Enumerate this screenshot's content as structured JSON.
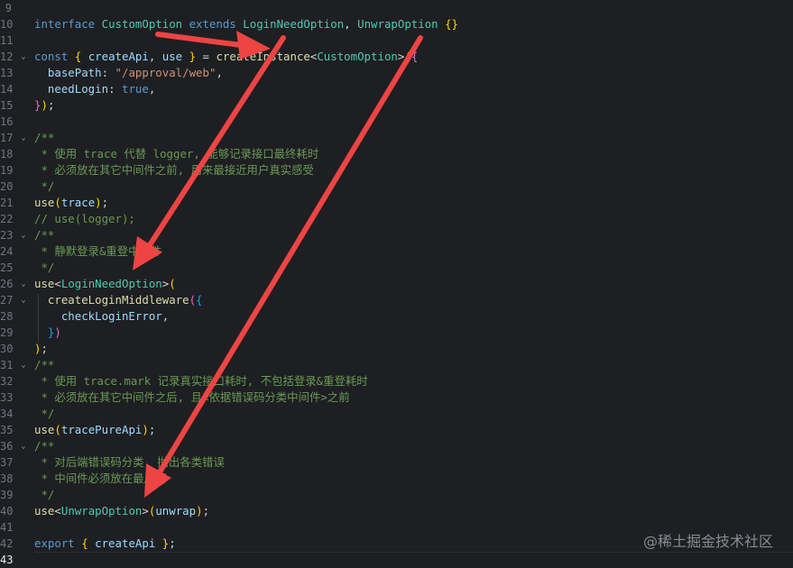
{
  "editor": {
    "lines": [
      {
        "num": "9",
        "fold": "",
        "tokens": []
      },
      {
        "num": "10",
        "fold": "",
        "tokens": [
          {
            "t": "interface ",
            "c": "kw"
          },
          {
            "t": "CustomOption ",
            "c": "type"
          },
          {
            "t": "extends ",
            "c": "kw"
          },
          {
            "t": "LoginNeedOption",
            "c": "type"
          },
          {
            "t": ", ",
            "c": "pun"
          },
          {
            "t": "UnwrapOption ",
            "c": "type"
          },
          {
            "t": "{}",
            "c": "p1"
          }
        ]
      },
      {
        "num": "11",
        "fold": "",
        "tokens": []
      },
      {
        "num": "12",
        "fold": "⌄",
        "tokens": [
          {
            "t": "const ",
            "c": "kw"
          },
          {
            "t": "{ ",
            "c": "p1"
          },
          {
            "t": "createApi",
            "c": "var"
          },
          {
            "t": ", ",
            "c": "pun"
          },
          {
            "t": "use ",
            "c": "var"
          },
          {
            "t": "} ",
            "c": "p1"
          },
          {
            "t": "= ",
            "c": "pun"
          },
          {
            "t": "createInstance",
            "c": "fn"
          },
          {
            "t": "<",
            "c": "pun"
          },
          {
            "t": "CustomOption",
            "c": "type"
          },
          {
            "t": ">",
            "c": "pun"
          },
          {
            "t": "(",
            "c": "p1"
          },
          {
            "t": "{",
            "c": "p2"
          }
        ]
      },
      {
        "num": "13",
        "fold": "",
        "tokens": [
          {
            "t": "  basePath",
            "c": "prop"
          },
          {
            "t": ": ",
            "c": "pun"
          },
          {
            "t": "\"/approval/web\"",
            "c": "str"
          },
          {
            "t": ",",
            "c": "pun"
          }
        ]
      },
      {
        "num": "14",
        "fold": "",
        "tokens": [
          {
            "t": "  needLogin",
            "c": "prop"
          },
          {
            "t": ": ",
            "c": "pun"
          },
          {
            "t": "true",
            "c": "bool"
          },
          {
            "t": ",",
            "c": "pun"
          }
        ]
      },
      {
        "num": "15",
        "fold": "",
        "tokens": [
          {
            "t": "}",
            "c": "p2"
          },
          {
            "t": ")",
            "c": "p1"
          },
          {
            "t": ";",
            "c": "pun"
          }
        ]
      },
      {
        "num": "16",
        "fold": "",
        "tokens": []
      },
      {
        "num": "17",
        "fold": "⌄",
        "tokens": [
          {
            "t": "/**",
            "c": "cmt"
          }
        ]
      },
      {
        "num": "18",
        "fold": "",
        "tokens": [
          {
            "t": " * 使用 trace 代替 logger, 能够记录接口最终耗时",
            "c": "cmt"
          }
        ]
      },
      {
        "num": "19",
        "fold": "",
        "tokens": [
          {
            "t": " * 必须放在其它中间件之前, 用来最接近用户真实感受",
            "c": "cmt"
          }
        ]
      },
      {
        "num": "20",
        "fold": "",
        "tokens": [
          {
            "t": " */",
            "c": "cmt"
          }
        ]
      },
      {
        "num": "21",
        "fold": "",
        "tokens": [
          {
            "t": "use",
            "c": "fn"
          },
          {
            "t": "(",
            "c": "p1"
          },
          {
            "t": "trace",
            "c": "var"
          },
          {
            "t": ")",
            "c": "p1"
          },
          {
            "t": ";",
            "c": "pun"
          }
        ]
      },
      {
        "num": "22",
        "fold": "",
        "tokens": [
          {
            "t": "// use(logger);",
            "c": "cmt"
          }
        ]
      },
      {
        "num": "23",
        "fold": "⌄",
        "tokens": [
          {
            "t": "/**",
            "c": "cmt"
          }
        ]
      },
      {
        "num": "24",
        "fold": "",
        "tokens": [
          {
            "t": " * 静默登录&重登中间件",
            "c": "cmt"
          }
        ]
      },
      {
        "num": "25",
        "fold": "",
        "tokens": [
          {
            "t": " */",
            "c": "cmt"
          }
        ]
      },
      {
        "num": "26",
        "fold": "⌄",
        "tokens": [
          {
            "t": "use",
            "c": "fn"
          },
          {
            "t": "<",
            "c": "pun"
          },
          {
            "t": "LoginNeedOption",
            "c": "type"
          },
          {
            "t": ">",
            "c": "pun"
          },
          {
            "t": "(",
            "c": "p1"
          }
        ]
      },
      {
        "num": "27",
        "fold": "⌄",
        "tokens": [
          {
            "t": "  createLoginMiddleware",
            "c": "fn"
          },
          {
            "t": "(",
            "c": "p2"
          },
          {
            "t": "{",
            "c": "p3"
          }
        ]
      },
      {
        "num": "28",
        "fold": "",
        "tokens": [
          {
            "t": "    checkLoginError",
            "c": "var"
          },
          {
            "t": ",",
            "c": "pun"
          }
        ]
      },
      {
        "num": "29",
        "fold": "",
        "tokens": [
          {
            "t": "  ",
            "c": "pun"
          },
          {
            "t": "}",
            "c": "p3"
          },
          {
            "t": ")",
            "c": "p2"
          }
        ]
      },
      {
        "num": "30",
        "fold": "",
        "tokens": [
          {
            "t": ")",
            "c": "p1"
          },
          {
            "t": ";",
            "c": "pun"
          }
        ]
      },
      {
        "num": "31",
        "fold": "⌄",
        "tokens": [
          {
            "t": "/**",
            "c": "cmt"
          }
        ]
      },
      {
        "num": "32",
        "fold": "",
        "tokens": [
          {
            "t": " * 使用 trace.mark 记录真实接口耗时, 不包括登录&重登耗时",
            "c": "cmt"
          }
        ]
      },
      {
        "num": "33",
        "fold": "",
        "tokens": [
          {
            "t": " * 必须放在其它中间件之后, 且<依据错误码分类中间件>之前",
            "c": "cmt"
          }
        ]
      },
      {
        "num": "34",
        "fold": "",
        "tokens": [
          {
            "t": " */",
            "c": "cmt"
          }
        ]
      },
      {
        "num": "35",
        "fold": "",
        "tokens": [
          {
            "t": "use",
            "c": "fn"
          },
          {
            "t": "(",
            "c": "p1"
          },
          {
            "t": "tracePureApi",
            "c": "var"
          },
          {
            "t": ")",
            "c": "p1"
          },
          {
            "t": ";",
            "c": "pun"
          }
        ]
      },
      {
        "num": "36",
        "fold": "⌄",
        "tokens": [
          {
            "t": "/**",
            "c": "cmt"
          }
        ]
      },
      {
        "num": "37",
        "fold": "",
        "tokens": [
          {
            "t": " * 对后端错误码分类, 抛出各类错误",
            "c": "cmt"
          }
        ]
      },
      {
        "num": "38",
        "fold": "",
        "tokens": [
          {
            "t": " * 中间件必须放在最后面",
            "c": "cmt"
          }
        ]
      },
      {
        "num": "39",
        "fold": "",
        "tokens": [
          {
            "t": " */",
            "c": "cmt"
          }
        ]
      },
      {
        "num": "40",
        "fold": "",
        "tokens": [
          {
            "t": "use",
            "c": "fn"
          },
          {
            "t": "<",
            "c": "pun"
          },
          {
            "t": "UnwrapOption",
            "c": "type"
          },
          {
            "t": ">",
            "c": "pun"
          },
          {
            "t": "(",
            "c": "p1"
          },
          {
            "t": "unwrap",
            "c": "var"
          },
          {
            "t": ")",
            "c": "p1"
          },
          {
            "t": ";",
            "c": "pun"
          }
        ]
      },
      {
        "num": "41",
        "fold": "",
        "tokens": []
      },
      {
        "num": "42",
        "fold": "",
        "tokens": [
          {
            "t": "export ",
            "c": "kw"
          },
          {
            "t": "{ ",
            "c": "p1"
          },
          {
            "t": "createApi ",
            "c": "var"
          },
          {
            "t": "}",
            "c": "p1"
          },
          {
            "t": ";",
            "c": "pun"
          }
        ]
      },
      {
        "num": "43",
        "fold": "",
        "tokens": [],
        "current": true
      }
    ]
  },
  "colors": {
    "background": "#1e1f22",
    "arrow": "#ee4444"
  },
  "watermark": {
    "text": "@稀土掘金技术社区"
  }
}
